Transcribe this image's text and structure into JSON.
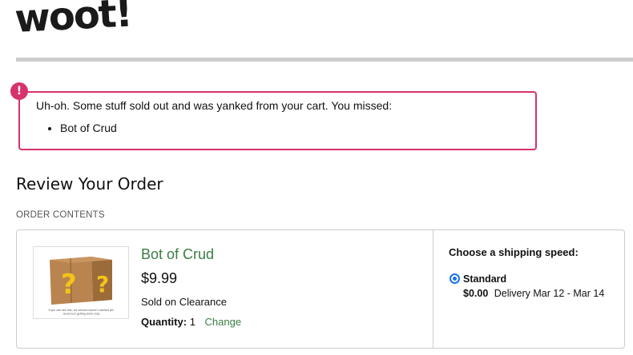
{
  "brand": {
    "logo_text": "woot!"
  },
  "alert": {
    "icon": "exclamation-icon",
    "message": "Uh-oh. Some stuff sold out and was yanked from your cart. You missed:",
    "missed_items": [
      "Bot of Crud"
    ],
    "color": "#d6336c"
  },
  "review": {
    "title": "Review Your Order",
    "section_label": "ORDER CONTENTS"
  },
  "item": {
    "image_caption": "If you can see this, our servers haven't crashed yet. Good luck getting some crap.",
    "name": "Bot of Crud",
    "price": "$9.99",
    "status": "Sold on Clearance",
    "quantity_label": "Quantity:",
    "quantity": "1",
    "change_label": "Change"
  },
  "shipping": {
    "title": "Choose a shipping speed:",
    "options": [
      {
        "name": "Standard",
        "price": "$0.00",
        "delivery": "Delivery Mar 12 - Mar 14",
        "selected": true
      }
    ]
  },
  "colors": {
    "accent_green": "#3a7d44",
    "alert_pink": "#d6336c",
    "radio_blue": "#1a73e8"
  }
}
